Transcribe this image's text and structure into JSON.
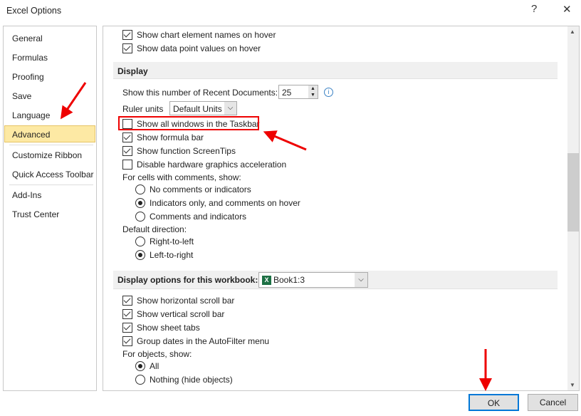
{
  "window": {
    "title": "Excel Options",
    "help": "?",
    "close": "✕"
  },
  "sidebar": {
    "items": [
      "General",
      "Formulas",
      "Proofing",
      "Save",
      "Language",
      "Advanced",
      "Customize Ribbon",
      "Quick Access Toolbar",
      "Add-Ins",
      "Trust Center"
    ],
    "active": "Advanced"
  },
  "main": {
    "top_items": [
      {
        "label": "Show chart element names on hover",
        "checked": true
      },
      {
        "label": "Show data point values on hover",
        "checked": true
      }
    ],
    "display": {
      "header": "Display",
      "recent_docs_label": "Show this number of Recent Documents:",
      "recent_docs_value": "25",
      "ruler_label": "Ruler units",
      "ruler_value": "Default Units",
      "items": [
        {
          "label": "Show all windows in the Taskbar",
          "checked": false
        },
        {
          "label": "Show formula bar",
          "checked": true
        },
        {
          "label": "Show function ScreenTips",
          "checked": true
        },
        {
          "label": "Disable hardware graphics acceleration",
          "checked": false
        }
      ],
      "comments_label": "For cells with comments, show:",
      "comments_options": [
        {
          "label": "No comments or indicators",
          "selected": false
        },
        {
          "label": "Indicators only, and comments on hover",
          "selected": true
        },
        {
          "label": "Comments and indicators",
          "selected": false
        }
      ],
      "direction_label": "Default direction:",
      "direction_options": [
        {
          "label": "Right-to-left",
          "selected": false
        },
        {
          "label": "Left-to-right",
          "selected": true
        }
      ]
    },
    "workbook": {
      "header": "Display options for this workbook:",
      "selected": "Book1:3",
      "items": [
        {
          "label": "Show horizontal scroll bar",
          "checked": true
        },
        {
          "label": "Show vertical scroll bar",
          "checked": true
        },
        {
          "label": "Show sheet tabs",
          "checked": true
        },
        {
          "label": "Group dates in the AutoFilter menu",
          "checked": true
        }
      ],
      "objects_label": "For objects, show:",
      "objects_options": [
        {
          "label": "All",
          "selected": true
        },
        {
          "label": "Nothing (hide objects)",
          "selected": false
        }
      ]
    }
  },
  "buttons": {
    "ok": "OK",
    "cancel": "Cancel"
  },
  "colors": {
    "annotation": "#e00000",
    "active_item": "#fde9a4",
    "ok_border": "#0078d7"
  }
}
